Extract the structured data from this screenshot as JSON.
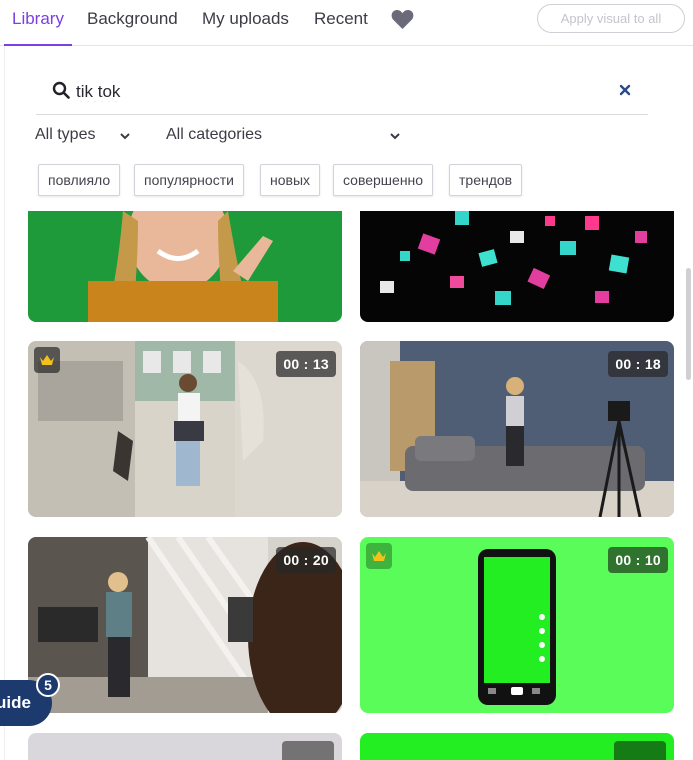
{
  "tabs": [
    {
      "label": "Library",
      "active": true
    },
    {
      "label": "Background",
      "active": false
    },
    {
      "label": "My uploads",
      "active": false
    },
    {
      "label": "Recent",
      "active": false
    }
  ],
  "favorites_icon": "heart-icon",
  "apply_button": "Apply visual to all",
  "search": {
    "value": "tik tok",
    "icon": "search-icon",
    "clear_icon": "close-icon"
  },
  "filters": {
    "type": "All types",
    "category": "All categories"
  },
  "suggestions": [
    "повлияло",
    "популярности",
    "новых",
    "совершенно",
    "трендов"
  ],
  "cards": [
    {
      "duration": "",
      "premium": false
    },
    {
      "duration": "",
      "premium": false
    },
    {
      "duration": "00 : 13",
      "premium": true
    },
    {
      "duration": "00 : 18",
      "premium": false
    },
    {
      "duration": "00 : 20",
      "premium": false
    },
    {
      "duration": "00 : 10",
      "premium": true
    }
  ],
  "guide": {
    "label": "uide",
    "count": "5"
  },
  "colors": {
    "accent": "#7b3fe4",
    "guide": "#1c3a6e",
    "green_screen": "#5afc5a"
  }
}
